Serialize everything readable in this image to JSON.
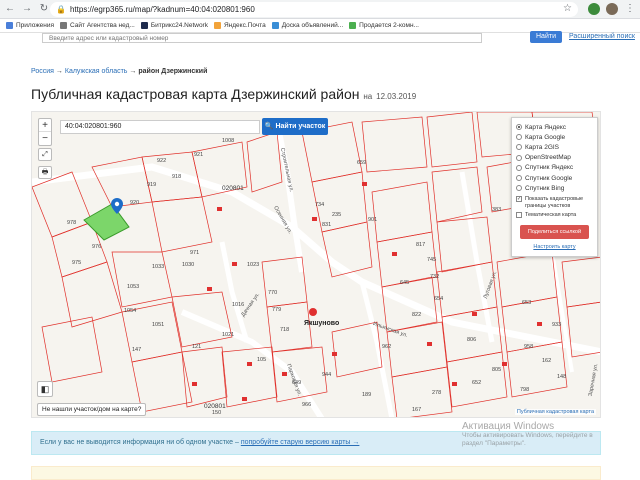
{
  "browser": {
    "url": "https://egrp365.ru/map/?kadnum=40:04:020801:960",
    "bookmarks": [
      {
        "label": "Приложения",
        "color": "#4a7fd9"
      },
      {
        "label": "Сайт Агентства нед...",
        "color": "#777777"
      },
      {
        "label": "Битрикс24.Network",
        "color": "#1e2b4d"
      },
      {
        "label": "Яндекс.Почта",
        "color": "#f2a33a"
      },
      {
        "label": "Доска объявлений...",
        "color": "#3a8ed6"
      },
      {
        "label": "Продается 2-комн...",
        "color": "#4caf50"
      }
    ]
  },
  "site_search": {
    "placeholder": "Введите адрес или кадастровый номер",
    "button": "Найти",
    "advanced": "Расширенный поиск"
  },
  "breadcrumb": {
    "items": [
      "Россия",
      "Калужская область"
    ],
    "sep": "→",
    "current": "район Дзержинский"
  },
  "title": {
    "main": "Публичная кадастровая карта Дзержинский район",
    "date_prefix": "на",
    "date": "12.03.2019"
  },
  "map": {
    "zoom_in": "+",
    "zoom_out": "−",
    "fullscreen_icon": "⤢",
    "print_icon": "🖶",
    "coord_value": "40:04:020801:960",
    "find_button": "Найти участок",
    "layers": [
      {
        "label": "Карта Яндекс",
        "selected": true
      },
      {
        "label": "Карта Google",
        "selected": false
      },
      {
        "label": "Карта 2GIS",
        "selected": false
      },
      {
        "label": "OpenStreetMap",
        "selected": false
      },
      {
        "label": "Спутник Яндекс",
        "selected": false
      },
      {
        "label": "Спутник Google",
        "selected": false
      },
      {
        "label": "Спутник Bing",
        "selected": false
      }
    ],
    "show_boundaries": "Показать кадастровые границы участков",
    "thematic_map": "Тематическая карта",
    "share_button": "Поделиться ссылкой",
    "configure_map": "Настроить карту",
    "not_found": "Не нашли участок/дом на карте?",
    "pkk_link": "Публичная кадастровая карта",
    "village": "Якшуново",
    "roads": [
      "Строительная ул.",
      "Дачная ул.",
      "Парковая ул.",
      "Ильинская ул.",
      "Луговая ул.",
      "Заречная ул.",
      "Осенняя ул."
    ],
    "quarters": [
      "020801",
      "020801"
    ],
    "parcels": [
      "1008",
      "921",
      "922",
      "918",
      "919",
      "920",
      "659",
      "978",
      "976",
      "975",
      "971",
      "1030",
      "1033",
      "1053",
      "1054",
      "1023",
      "1016",
      "1021",
      "1051",
      "147",
      "734",
      "235",
      "831",
      "901",
      "817",
      "745",
      "732",
      "383",
      "653",
      "654",
      "822",
      "645",
      "718",
      "770",
      "779",
      "649",
      "944",
      "966",
      "962",
      "958",
      "933",
      "798",
      "806",
      "805",
      "652",
      "278",
      "167",
      "189",
      "162",
      "148",
      "121",
      "105",
      "150"
    ]
  },
  "info": {
    "text": "Если у вас не выводится информация ни об одном участке –",
    "link": "попробуйте старую версию карты →"
  },
  "watermark": {
    "title": "Активация Windows",
    "line1": "Чтобы активировать Windows, перейдите в",
    "line2": "раздел \"Параметры\"."
  }
}
